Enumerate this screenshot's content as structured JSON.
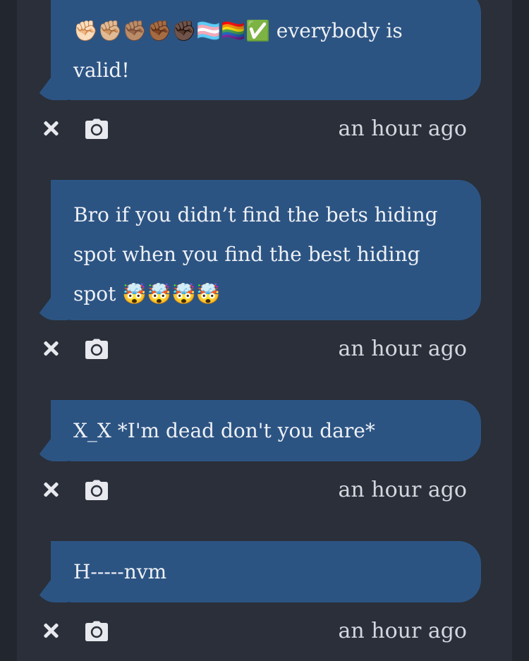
{
  "messages": [
    {
      "text": "✊🏻✊🏼✊🏽✊🏾✊🏿🏳️‍⚧️🏳️‍🌈✅ everybody is valid!",
      "timestamp": "an hour ago"
    },
    {
      "text": "Bro if you didn’t find the bets hiding spot when you find the best hiding spot 🤯🤯🤯🤯",
      "timestamp": "an hour ago"
    },
    {
      "text": "X_X *I'm dead don't you dare*",
      "timestamp": "an hour ago"
    },
    {
      "text": "H-----nvm",
      "timestamp": "an hour ago"
    }
  ],
  "icons": {
    "delete": "close-icon",
    "screenshot": "camera-icon"
  },
  "colors": {
    "page_background": "#22262f",
    "feed_background": "#2a2f39",
    "bubble": "#2c5483",
    "bubble_text": "#eef1f6",
    "timestamp_text": "#d4d7de",
    "icon": "#e7e9ee"
  }
}
